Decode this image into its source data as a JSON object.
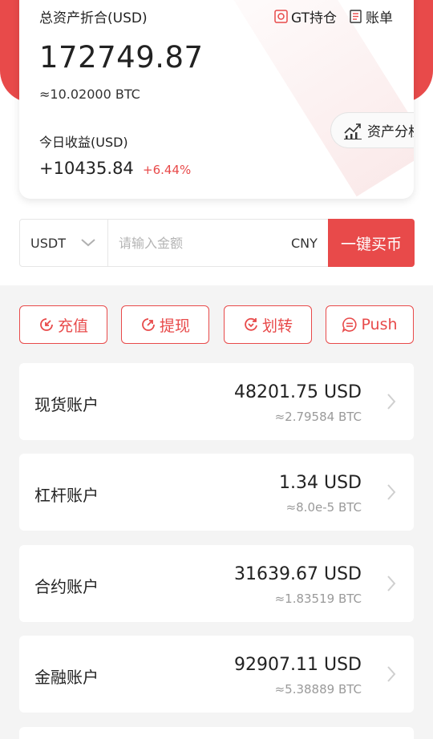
{
  "summary": {
    "total_label": "总资产折合(USD)",
    "gt_label": "GT持仓",
    "bill_label": "账单",
    "total_value": "172749.87",
    "total_btc": "≈10.02000 BTC",
    "income_label": "今日收益(USD)",
    "income_value": "+10435.84",
    "income_pct": "+6.44%",
    "analysis_label": "资产分析"
  },
  "buy": {
    "coin": "USDT",
    "placeholder": "请输入金额",
    "currency": "CNY",
    "button_label": "一键买币"
  },
  "actions": [
    {
      "label": "充值",
      "icon": "deposit-icon"
    },
    {
      "label": "提现",
      "icon": "withdraw-icon"
    },
    {
      "label": "划转",
      "icon": "transfer-icon"
    },
    {
      "label": "Push",
      "icon": "push-icon"
    }
  ],
  "accounts": [
    {
      "name": "现货账户",
      "usd": "48201.75 USD",
      "btc": "≈2.79584 BTC"
    },
    {
      "name": "杠杆账户",
      "usd": "1.34 USD",
      "btc": "≈8.0e-5 BTC"
    },
    {
      "name": "合约账户",
      "usd": "31639.67 USD",
      "btc": "≈1.83519 BTC"
    },
    {
      "name": "金融账户",
      "usd": "92907.11 USD",
      "btc": "≈5.38889 BTC"
    }
  ],
  "colors": {
    "accent": "#e84a4a",
    "background": "#f4f4f4",
    "muted_text": "#9a9a9a"
  }
}
